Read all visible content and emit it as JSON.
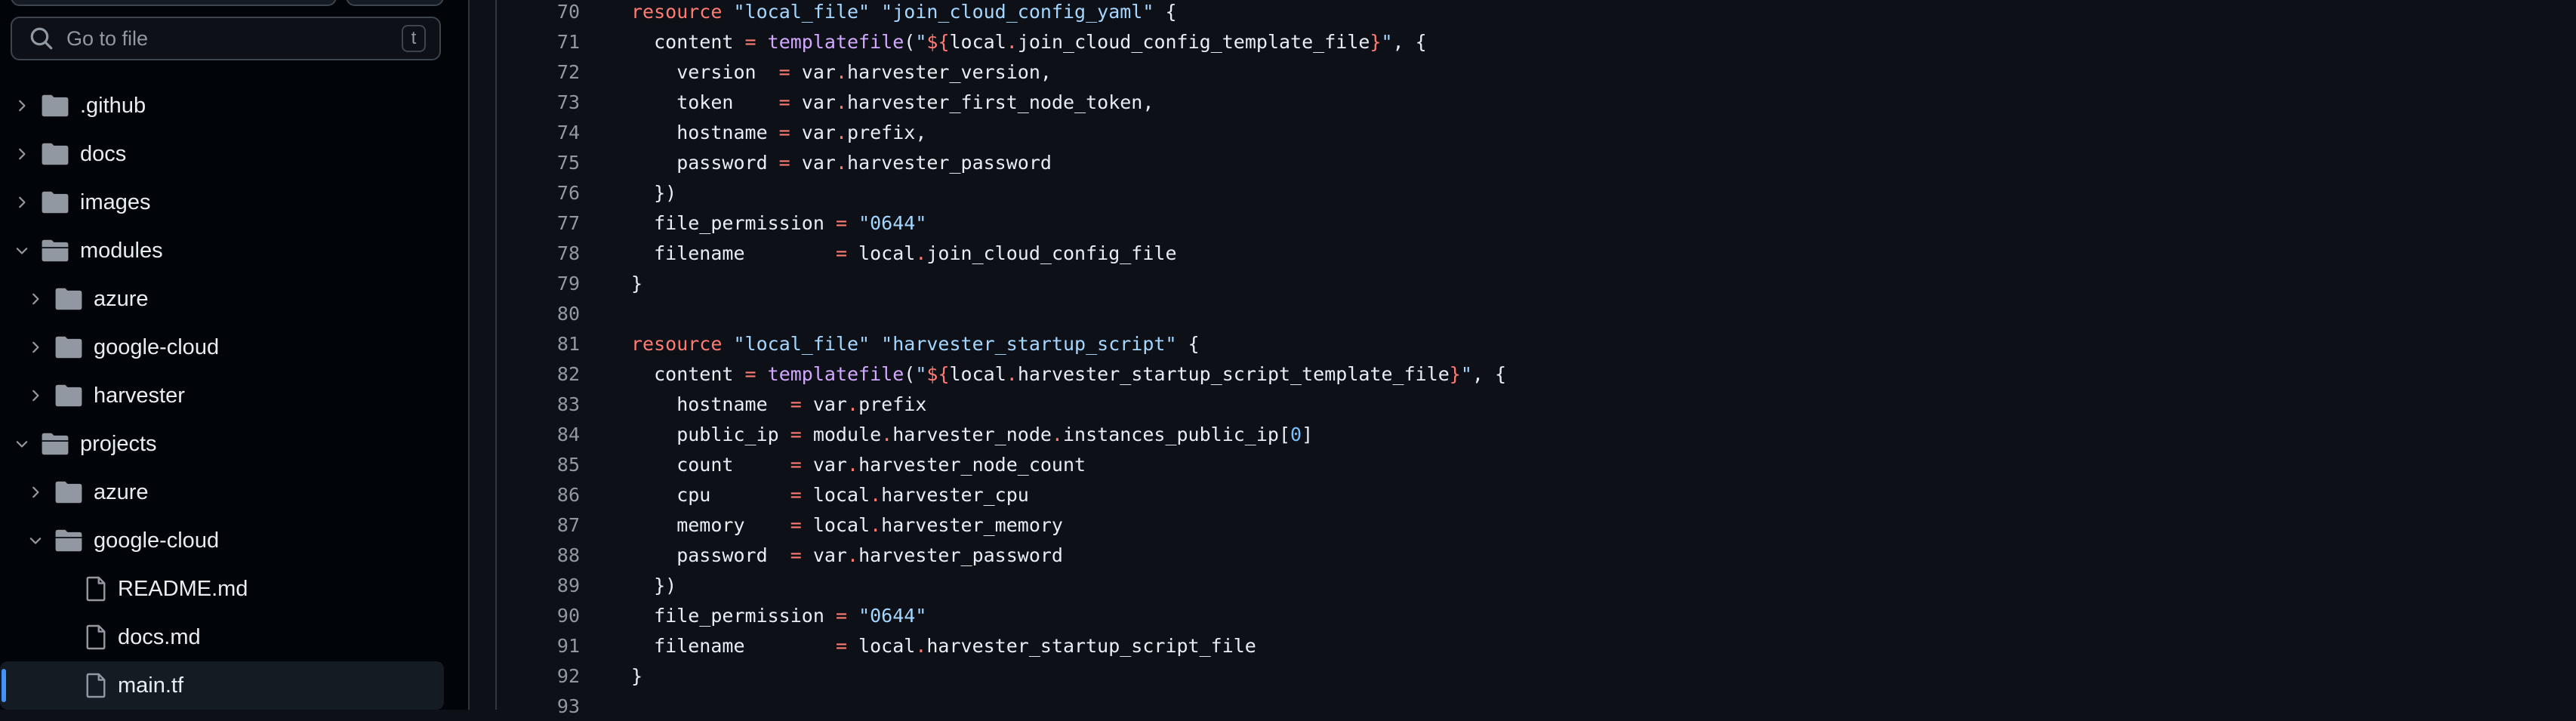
{
  "search": {
    "placeholder": "Go to file",
    "shortcut": "t"
  },
  "tree": [
    {
      "label": ".github",
      "type": "folder",
      "expanded": false,
      "depth": 0
    },
    {
      "label": "docs",
      "type": "folder",
      "expanded": false,
      "depth": 0
    },
    {
      "label": "images",
      "type": "folder",
      "expanded": false,
      "depth": 0
    },
    {
      "label": "modules",
      "type": "folder",
      "expanded": true,
      "depth": 0
    },
    {
      "label": "azure",
      "type": "folder",
      "expanded": false,
      "depth": 1
    },
    {
      "label": "google-cloud",
      "type": "folder",
      "expanded": false,
      "depth": 1
    },
    {
      "label": "harvester",
      "type": "folder",
      "expanded": false,
      "depth": 1
    },
    {
      "label": "projects",
      "type": "folder",
      "expanded": true,
      "depth": 0
    },
    {
      "label": "azure",
      "type": "folder",
      "expanded": false,
      "depth": 1
    },
    {
      "label": "google-cloud",
      "type": "folder",
      "expanded": true,
      "depth": 1
    },
    {
      "label": "README.md",
      "type": "file",
      "depth": 2
    },
    {
      "label": "docs.md",
      "type": "file",
      "depth": 2
    },
    {
      "label": "main.tf",
      "type": "file",
      "depth": 2,
      "selected": true
    }
  ],
  "code": {
    "lines": [
      {
        "n": "70",
        "t": [
          [
            "kw",
            "resource"
          ],
          [
            "",
            " "
          ],
          [
            "s",
            "\"local_file\""
          ],
          [
            "",
            " "
          ],
          [
            "s",
            "\"join_cloud_config_yaml\""
          ],
          [
            "",
            " {"
          ]
        ]
      },
      {
        "n": "71",
        "t": [
          [
            "",
            "  content "
          ],
          [
            "op",
            "="
          ],
          [
            "",
            " "
          ],
          [
            "fn",
            "templatefile"
          ],
          [
            "",
            "("
          ],
          [
            "s",
            "\""
          ],
          [
            "kw",
            "${"
          ],
          [
            "",
            "local"
          ],
          [
            "op",
            "."
          ],
          [
            "",
            "join_cloud_config_template_file"
          ],
          [
            "kw",
            "}"
          ],
          [
            "s",
            "\""
          ],
          [
            "",
            ", {"
          ]
        ]
      },
      {
        "n": "72",
        "t": [
          [
            "",
            "    version  "
          ],
          [
            "op",
            "="
          ],
          [
            "",
            " var"
          ],
          [
            "op",
            "."
          ],
          [
            "",
            "harvester_version,"
          ]
        ]
      },
      {
        "n": "73",
        "t": [
          [
            "",
            "    token    "
          ],
          [
            "op",
            "="
          ],
          [
            "",
            " var"
          ],
          [
            "op",
            "."
          ],
          [
            "",
            "harvester_first_node_token,"
          ]
        ]
      },
      {
        "n": "74",
        "t": [
          [
            "",
            "    hostname "
          ],
          [
            "op",
            "="
          ],
          [
            "",
            " var"
          ],
          [
            "op",
            "."
          ],
          [
            "",
            "prefix,"
          ]
        ]
      },
      {
        "n": "75",
        "t": [
          [
            "",
            "    password "
          ],
          [
            "op",
            "="
          ],
          [
            "",
            " var"
          ],
          [
            "op",
            "."
          ],
          [
            "",
            "harvester_password"
          ]
        ]
      },
      {
        "n": "76",
        "t": [
          [
            "",
            "  })"
          ]
        ]
      },
      {
        "n": "77",
        "t": [
          [
            "",
            "  file_permission "
          ],
          [
            "op",
            "="
          ],
          [
            "",
            " "
          ],
          [
            "s",
            "\"0644\""
          ]
        ]
      },
      {
        "n": "78",
        "t": [
          [
            "",
            "  filename        "
          ],
          [
            "op",
            "="
          ],
          [
            "",
            " local"
          ],
          [
            "op",
            "."
          ],
          [
            "",
            "join_cloud_config_file"
          ]
        ]
      },
      {
        "n": "79",
        "t": [
          [
            "",
            "}"
          ]
        ]
      },
      {
        "n": "80",
        "t": [
          [
            "",
            ""
          ]
        ]
      },
      {
        "n": "81",
        "t": [
          [
            "kw",
            "resource"
          ],
          [
            "",
            " "
          ],
          [
            "s",
            "\"local_file\""
          ],
          [
            "",
            " "
          ],
          [
            "s",
            "\"harvester_startup_script\""
          ],
          [
            "",
            " {"
          ]
        ]
      },
      {
        "n": "82",
        "t": [
          [
            "",
            "  content "
          ],
          [
            "op",
            "="
          ],
          [
            "",
            " "
          ],
          [
            "fn",
            "templatefile"
          ],
          [
            "",
            "("
          ],
          [
            "s",
            "\""
          ],
          [
            "kw",
            "${"
          ],
          [
            "",
            "local"
          ],
          [
            "op",
            "."
          ],
          [
            "",
            "harvester_startup_script_template_file"
          ],
          [
            "kw",
            "}"
          ],
          [
            "s",
            "\""
          ],
          [
            "",
            ", {"
          ]
        ]
      },
      {
        "n": "83",
        "t": [
          [
            "",
            "    hostname  "
          ],
          [
            "op",
            "="
          ],
          [
            "",
            " var"
          ],
          [
            "op",
            "."
          ],
          [
            "",
            "prefix"
          ]
        ]
      },
      {
        "n": "84",
        "t": [
          [
            "",
            "    public_ip "
          ],
          [
            "op",
            "="
          ],
          [
            "",
            " module"
          ],
          [
            "op",
            "."
          ],
          [
            "",
            "harvester_node"
          ],
          [
            "op",
            "."
          ],
          [
            "",
            "instances_public_ip["
          ],
          [
            "nm",
            "0"
          ],
          [
            "",
            "]"
          ]
        ]
      },
      {
        "n": "85",
        "t": [
          [
            "",
            "    count     "
          ],
          [
            "op",
            "="
          ],
          [
            "",
            " var"
          ],
          [
            "op",
            "."
          ],
          [
            "",
            "harvester_node_count"
          ]
        ]
      },
      {
        "n": "86",
        "t": [
          [
            "",
            "    cpu       "
          ],
          [
            "op",
            "="
          ],
          [
            "",
            " local"
          ],
          [
            "op",
            "."
          ],
          [
            "",
            "harvester_cpu"
          ]
        ]
      },
      {
        "n": "87",
        "t": [
          [
            "",
            "    memory    "
          ],
          [
            "op",
            "="
          ],
          [
            "",
            " local"
          ],
          [
            "op",
            "."
          ],
          [
            "",
            "harvester_memory"
          ]
        ]
      },
      {
        "n": "88",
        "t": [
          [
            "",
            "    password  "
          ],
          [
            "op",
            "="
          ],
          [
            "",
            " var"
          ],
          [
            "op",
            "."
          ],
          [
            "",
            "harvester_password"
          ]
        ]
      },
      {
        "n": "89",
        "t": [
          [
            "",
            "  })"
          ]
        ]
      },
      {
        "n": "90",
        "t": [
          [
            "",
            "  file_permission "
          ],
          [
            "op",
            "="
          ],
          [
            "",
            " "
          ],
          [
            "s",
            "\"0644\""
          ]
        ]
      },
      {
        "n": "91",
        "t": [
          [
            "",
            "  filename        "
          ],
          [
            "op",
            "="
          ],
          [
            "",
            " local"
          ],
          [
            "op",
            "."
          ],
          [
            "",
            "harvester_startup_script_file"
          ]
        ]
      },
      {
        "n": "92",
        "t": [
          [
            "",
            "}"
          ]
        ]
      },
      {
        "n": "93",
        "t": [
          [
            "",
            ""
          ]
        ]
      }
    ]
  },
  "icons": {
    "search": "search-icon",
    "folder": "folder-icon",
    "folder_open": "folder-open-icon",
    "file": "file-icon",
    "chevron_right": "chevron-right-icon",
    "chevron_down": "chevron-down-icon"
  },
  "colors": {
    "background": "#0d1117",
    "sidebar": "#010409",
    "selection_accent": "#4493f8",
    "keyword": "#ff7b72",
    "string": "#a5d6ff",
    "function": "#d2a8ff"
  }
}
